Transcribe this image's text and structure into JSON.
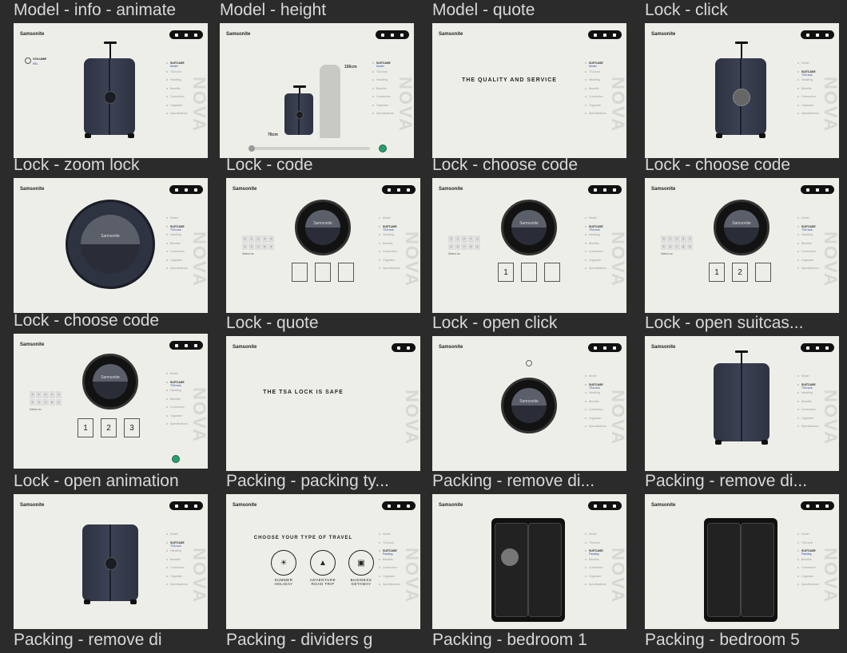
{
  "frames": [
    {
      "title": "Model - info - animate"
    },
    {
      "title": "Model - height"
    },
    {
      "title": "Model - quote"
    },
    {
      "title": "Lock - click"
    },
    {
      "title": "Lock - zoom lock"
    },
    {
      "title": "Lock - code"
    },
    {
      "title": "Lock - choose code"
    },
    {
      "title": "Lock - choose code"
    },
    {
      "title": "Lock - choose code"
    },
    {
      "title": "Lock - quote"
    },
    {
      "title": "Lock - open click"
    },
    {
      "title": "Lock - open suitcas..."
    },
    {
      "title": "Lock - open animation"
    },
    {
      "title": "Packing - packing ty..."
    },
    {
      "title": "Packing - remove di..."
    },
    {
      "title": "Packing - remove di..."
    },
    {
      "title": "Packing - remove di"
    },
    {
      "title": "Packing - dividers g"
    },
    {
      "title": "Packing - bedroom 1"
    },
    {
      "title": "Packing - bedroom 5"
    }
  ],
  "brand": "Samsonite",
  "side_word": "NOVA",
  "nav_items": [
    "Model",
    "TSA lock",
    "Handling",
    "Benefits",
    "Connection",
    "Organizer",
    "Specifications"
  ],
  "nav_active_label": "SUITCASE",
  "nav_active_sub_model": "Model",
  "nav_active_sub_lock": "TSA lock",
  "nav_active_sub_packing": "Packing",
  "volume_label": "VOLUME",
  "volume_value": "95L",
  "height_value": "156cm",
  "width_value": "76cm",
  "quote_model": "THE QUALITY AND SERVICE",
  "quote_lock": "THE TSA LOCK IS SAFE",
  "choose_travel": "CHOOSE YOUR TYPE OF TRAVEL",
  "travel_types": [
    "SUMMER HOLIDAY",
    "ADVENTURE ROAD TRIP",
    "BUSINESS GETAWAY"
  ],
  "keypad": [
    "0",
    "1",
    "2",
    "3",
    "4",
    "5",
    "6",
    "7",
    "8",
    "9"
  ],
  "code_caption": "Select no",
  "codes": {
    "one": "1",
    "two": "2",
    "three": "3"
  },
  "lock_brand": "Samsonite"
}
